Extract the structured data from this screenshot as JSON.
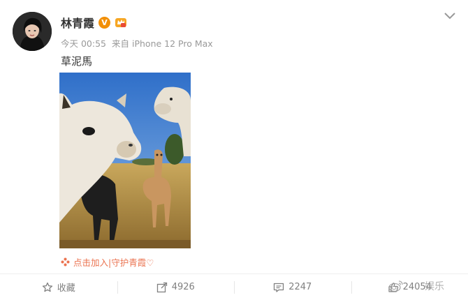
{
  "post": {
    "author": "林青霞",
    "time": "今天 00:55",
    "source_prefix": "来自",
    "source": "iPhone 12 Pro Max",
    "content": "草泥馬",
    "verified_badge": "V",
    "super_topic": "点击加入|守护青霞♡"
  },
  "actions": {
    "favorite": "收藏",
    "repost_count": "4926",
    "comment_count": "2247",
    "like_count": "24054"
  },
  "watermark": "娱乐",
  "icons": [
    "avatar",
    "verified-badge",
    "crown-icon",
    "chevron-down-icon",
    "flower-icon",
    "star-icon",
    "share-icon",
    "comment-icon",
    "like-icon"
  ],
  "colors": {
    "accent": "#eb7350",
    "badge": "#f29007",
    "text": "#333333",
    "muted": "#999999"
  }
}
